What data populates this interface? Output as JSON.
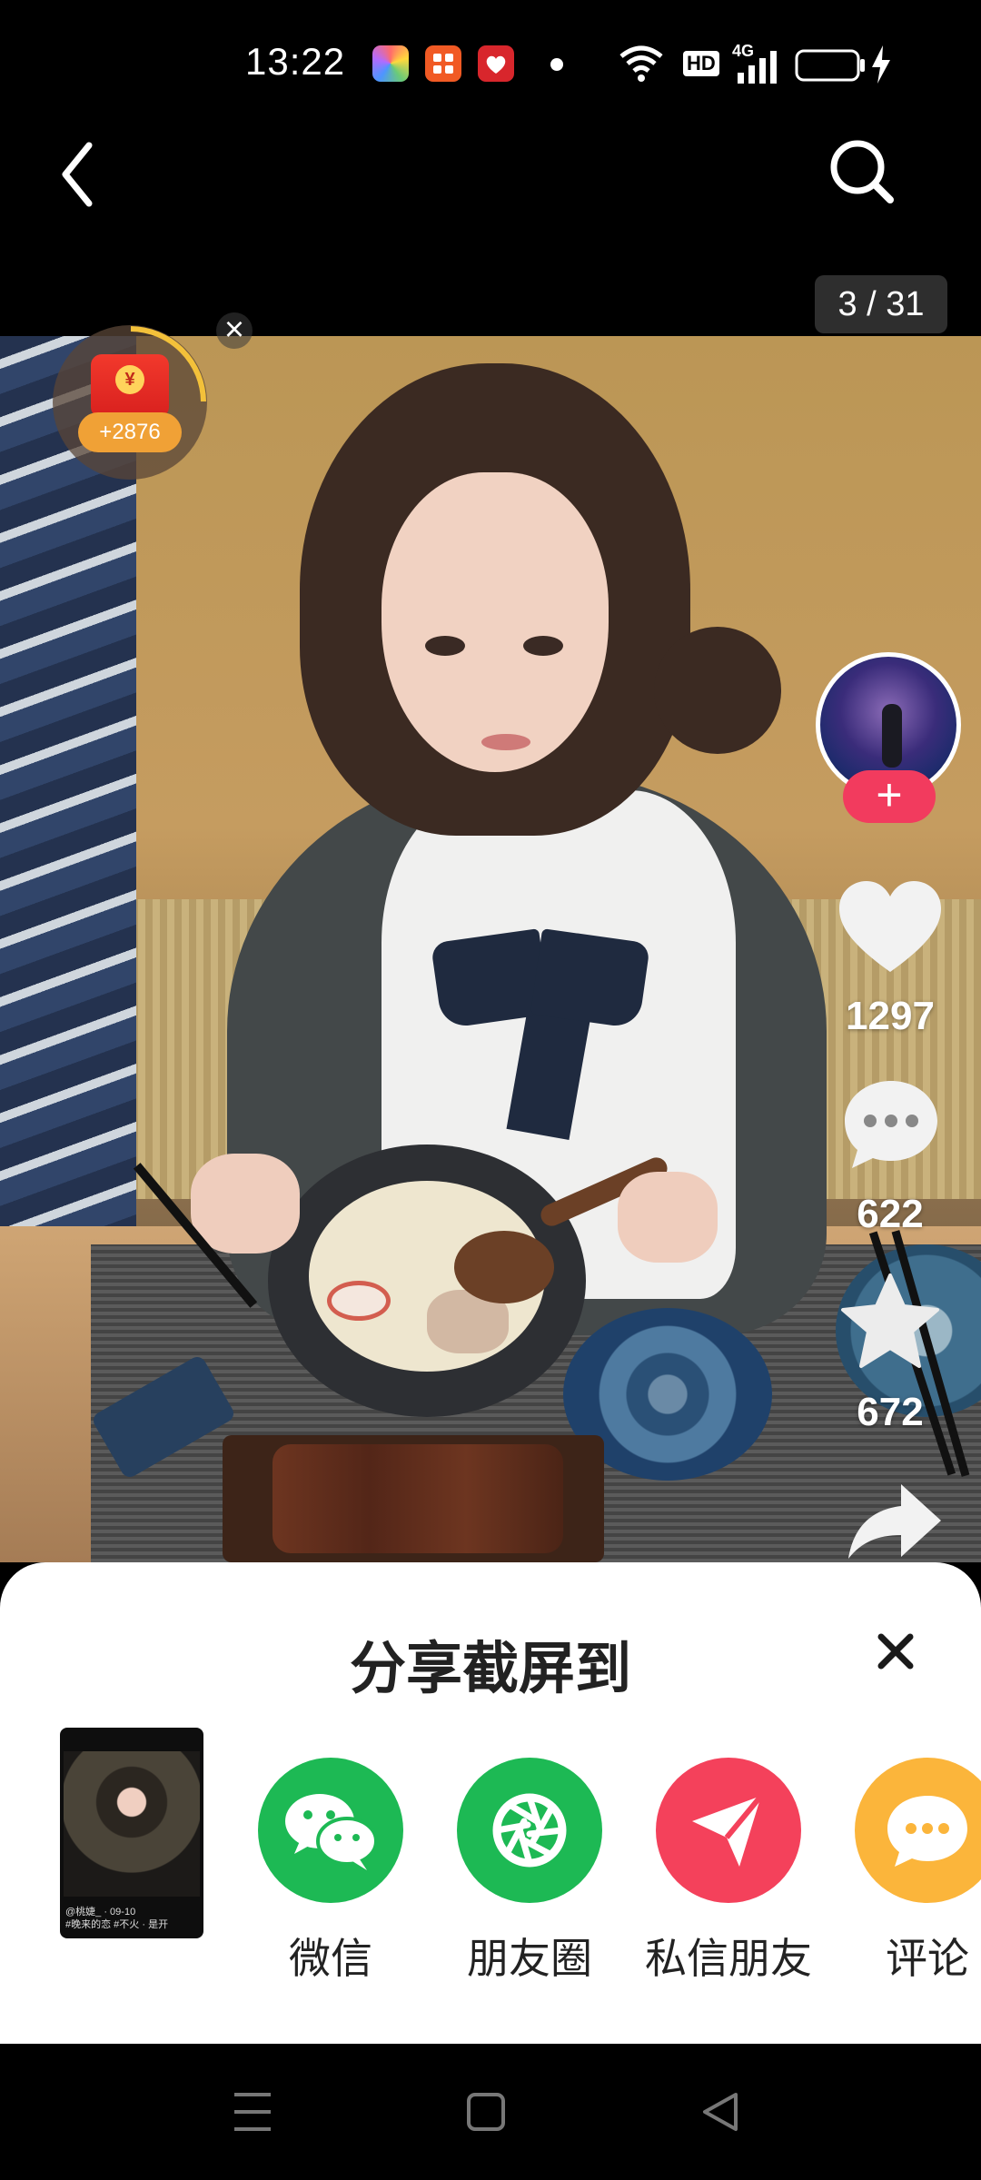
{
  "status_bar": {
    "time": "13:22",
    "hd": "HD",
    "network": "4G",
    "icons": [
      "photos-app-icon",
      "app-grid-icon",
      "red-heart-app-icon",
      "wifi-icon",
      "signal-icon",
      "battery-icon",
      "charging-bolt-icon"
    ]
  },
  "top_nav": {
    "back_icon": "chevron-left-icon",
    "search_icon": "search-icon"
  },
  "page_counter": "3 / 31",
  "red_packet": {
    "amount": "+2876",
    "coin": "¥",
    "close": "×"
  },
  "actions": {
    "follow": "+",
    "likes": "1297",
    "comments": "622",
    "favorites": "672"
  },
  "share_sheet": {
    "title": "分享截屏到",
    "thumbnail_caption_1": "@桃婕_ · 09-10",
    "thumbnail_caption_2": "#晚来的恋 #不火 · 是开",
    "targets": [
      {
        "label": "微信",
        "color": "#1db954"
      },
      {
        "label": "朋友圈",
        "color": "#1db954"
      },
      {
        "label": "私信朋友",
        "color": "#f4415b"
      },
      {
        "label": "评论",
        "color": "#fbb53b"
      }
    ]
  },
  "colors": {
    "accent_pink": "#f23b5e",
    "wechat_green": "#1db954",
    "comment_yellow": "#fbb53b"
  }
}
